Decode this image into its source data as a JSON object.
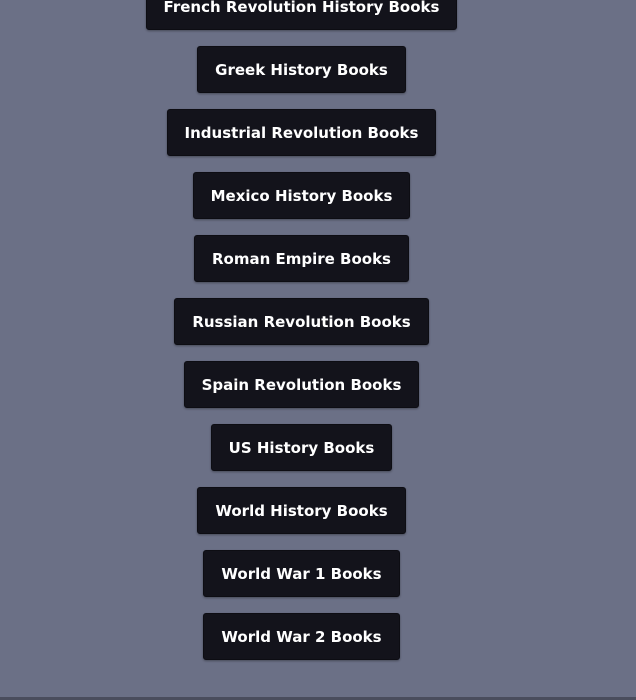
{
  "buttons": [
    {
      "label": "French Revolution History Books"
    },
    {
      "label": "Greek History Books"
    },
    {
      "label": "Industrial Revolution Books"
    },
    {
      "label": "Mexico History Books"
    },
    {
      "label": "Roman Empire Books"
    },
    {
      "label": "Russian Revolution Books"
    },
    {
      "label": "Spain Revolution Books"
    },
    {
      "label": "US History Books"
    },
    {
      "label": "World History Books"
    },
    {
      "label": "World War 1 Books"
    },
    {
      "label": "World War 2 Books"
    }
  ]
}
